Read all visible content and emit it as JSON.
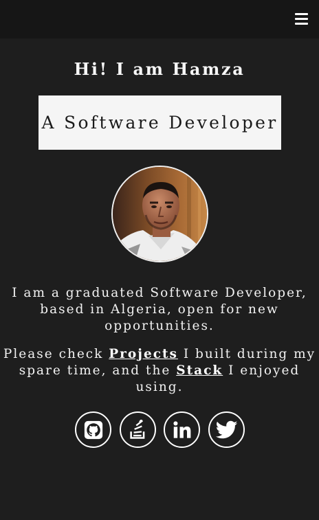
{
  "header": {
    "menu_icon": "hamburger-menu-icon"
  },
  "hero": {
    "greeting": "Hi! I am Hamza",
    "role": "A Software Developer",
    "avatar_icon": "profile-photo"
  },
  "intro": {
    "text": "I am a graduated Software Developer, based in Algeria, open for new opportunities."
  },
  "check": {
    "before": "Please check ",
    "projects_link": "Projects",
    "middle": " I built during my spare time, and the ",
    "stack_link": "Stack",
    "after": " I enjoyed using."
  },
  "socials": [
    {
      "name": "GitHub",
      "icon": "github-icon"
    },
    {
      "name": "Stack Overflow",
      "icon": "stackoverflow-icon"
    },
    {
      "name": "LinkedIn",
      "icon": "linkedin-icon"
    },
    {
      "name": "Twitter",
      "icon": "twitter-icon"
    }
  ],
  "colors": {
    "background": "#1e1e1e",
    "topbar": "#161616",
    "role_box": "#f5f5f5",
    "text": "#f2f2f2"
  }
}
